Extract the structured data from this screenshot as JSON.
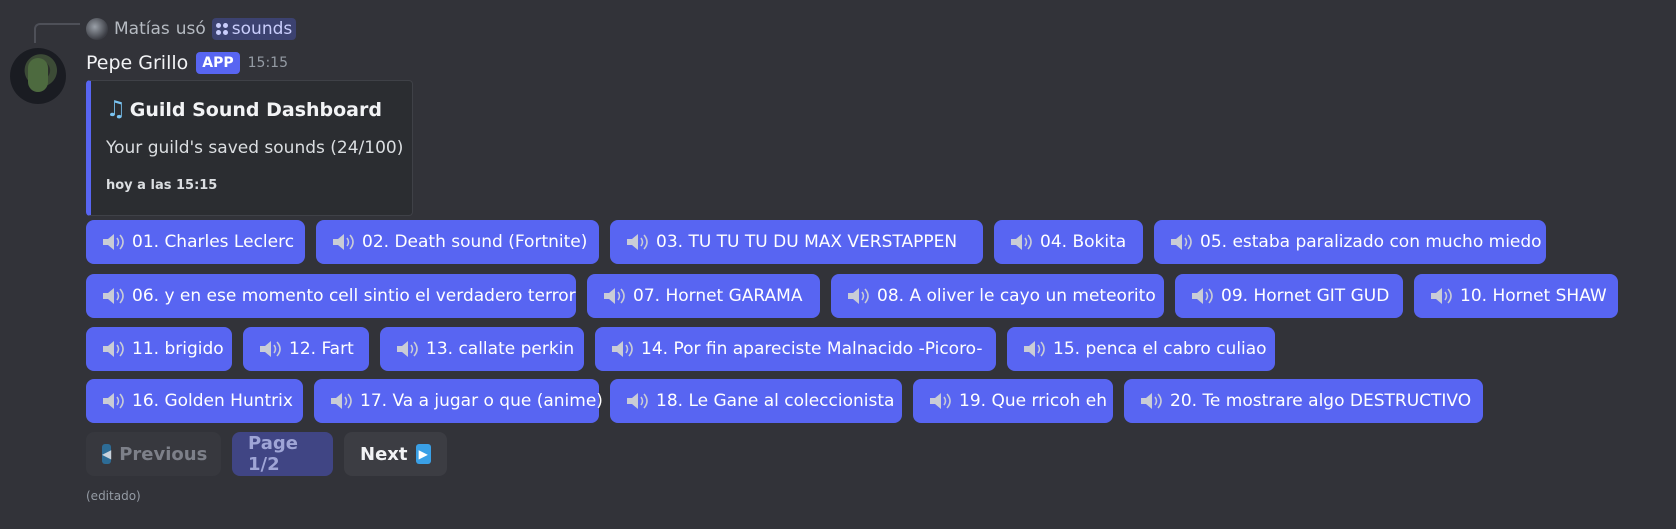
{
  "reply": {
    "user": "Matías",
    "action": "usó",
    "command": "sounds"
  },
  "message": {
    "username": "Pepe Grillo",
    "badge": "APP",
    "time": "15:15",
    "edited": "(editado)"
  },
  "embed": {
    "icon": "musical-note-icon",
    "title": "Guild Sound Dashboard",
    "description": "Your guild's saved sounds (24/100)",
    "footer": "hoy a las 15:15",
    "accent": "#5865f2"
  },
  "sounds": [
    "01. Charles Leclerc",
    "02. Death sound (Fortnite)",
    "03. TU TU TU DU MAX VERSTAPPEN",
    "04. Bokita",
    "05. estaba paralizado con mucho miedo",
    "06. y en ese momento cell sintio el verdadero terror",
    "07. Hornet GARAMA",
    "08. A oliver le cayo un meteorito",
    "09. Hornet GIT GUD",
    "10. Hornet SHAW",
    "11. brigido",
    "12. Fart",
    "13. callate perkin",
    "14. Por fin apareciste Malnacido -Picoro-",
    "15. penca el cabro culiao",
    "16. Golden Huntrix",
    "17. Va a jugar o que (anime)",
    "18. Le Gane al coleccionista",
    "19. Que rricoh eh",
    "20. Te mostrare algo DESTRUCTIVO"
  ],
  "pagination": {
    "previous": "Previous",
    "page": "Page 1/2",
    "next": "Next"
  },
  "colors": {
    "background": "#323339",
    "button": "#5865f2"
  }
}
